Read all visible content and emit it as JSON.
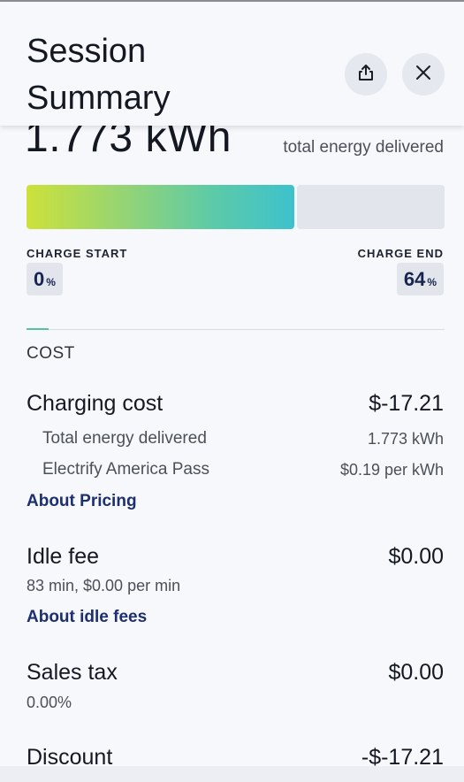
{
  "header": {
    "title": "Session Summary",
    "share_icon": "share-icon",
    "close_icon": "close-icon"
  },
  "energy": {
    "value": "1.773 kWh",
    "caption": "total energy delivered"
  },
  "charge": {
    "progress_percent": 64,
    "start_label": "CHARGE START",
    "start_value": "0",
    "start_unit": "%",
    "end_label": "CHARGE END",
    "end_value": "64",
    "end_unit": "%",
    "gradient_colors": [
      "#cde13a",
      "#3ec1cd"
    ]
  },
  "cost": {
    "section_label": "COST",
    "charging": {
      "title": "Charging cost",
      "amount": "$-17.21",
      "lines": [
        {
          "label": "Total energy delivered",
          "value": "1.773 kWh"
        },
        {
          "label": "Electrify America Pass",
          "value": "$0.19 per kWh"
        }
      ],
      "link": "About Pricing"
    },
    "idle": {
      "title": "Idle fee",
      "amount": "$0.00",
      "detail": "83 min, $0.00 per min",
      "link": "About idle fees"
    },
    "tax": {
      "title": "Sales tax",
      "amount": "$0.00",
      "detail": "0.00%"
    },
    "discount": {
      "title": "Discount",
      "amount": "-$-17.21"
    }
  },
  "colors": {
    "link": "#1c2f6e",
    "accent": "#56c2a2",
    "pill_bg": "#e3e5ec"
  }
}
